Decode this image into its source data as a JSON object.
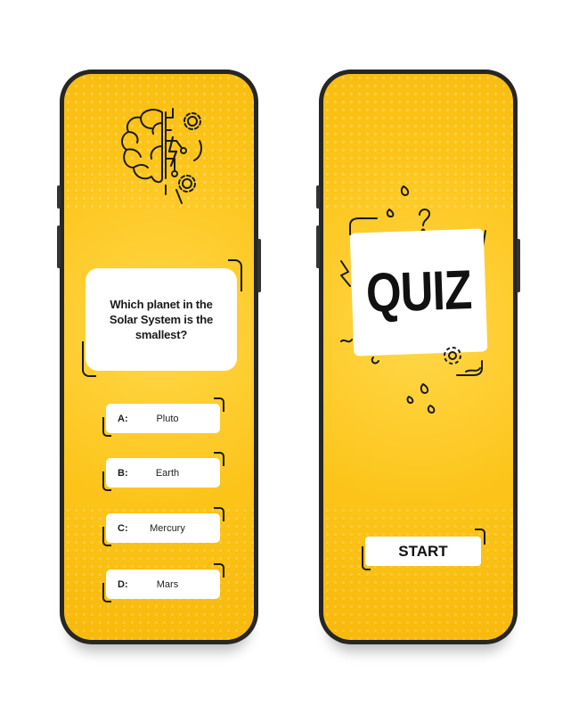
{
  "question_screen": {
    "question": "Which planet in the Solar System is the smallest?",
    "answers": [
      {
        "letter": "A:",
        "text": "Pluto"
      },
      {
        "letter": "B:",
        "text": "Earth"
      },
      {
        "letter": "C:",
        "text": "Mercury"
      },
      {
        "letter": "D:",
        "text": "Mars"
      }
    ],
    "icon": "brain-icon"
  },
  "start_screen": {
    "title": "QUIZ",
    "start_label": "START",
    "icon": "gear-icon"
  },
  "colors": {
    "screen_yellow": "#fcc419",
    "frame": "#262626",
    "ink": "#1a1a1a",
    "card": "#ffffff"
  }
}
